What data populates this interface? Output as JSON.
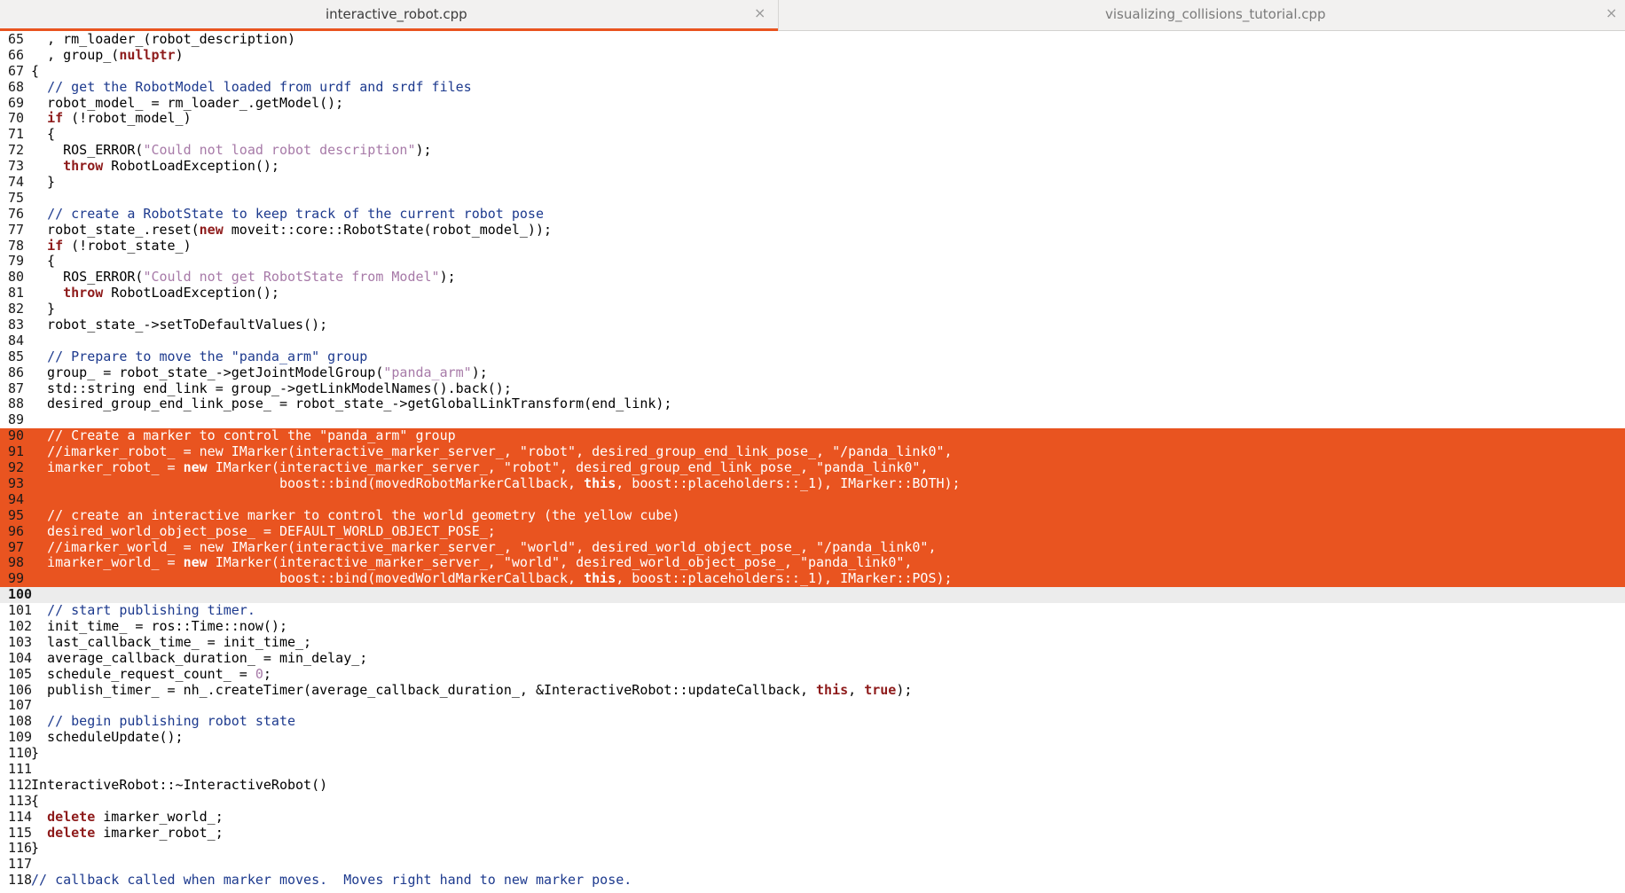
{
  "tabs": [
    {
      "label": "interactive_robot.cpp",
      "close": "×",
      "active": true
    },
    {
      "label": "visualizing_collisions_tutorial.cpp",
      "close": "×",
      "active": false
    }
  ],
  "icons": {
    "tab_close": "close-icon"
  },
  "colors": {
    "selection": "#e95420",
    "tab_accent": "#e9541f",
    "comment": "#1d3a8e",
    "string": "#a77aa8",
    "keyword": "#8e1b1b",
    "current_line": "#ececec"
  },
  "editor": {
    "current_line": 100,
    "selection": [
      90,
      99
    ],
    "lines": [
      {
        "n": "65",
        "segs": [
          {
            "t": "  , rm_loader_(robot_description)"
          }
        ]
      },
      {
        "n": "66",
        "segs": [
          {
            "t": "  , group_("
          },
          {
            "t": "nullptr",
            "c": "kw"
          },
          {
            "t": ")"
          }
        ]
      },
      {
        "n": "67",
        "segs": [
          {
            "t": "{"
          }
        ]
      },
      {
        "n": "68",
        "segs": [
          {
            "t": "  "
          },
          {
            "t": "// get the RobotModel loaded from urdf and srdf files",
            "c": "cm"
          }
        ]
      },
      {
        "n": "69",
        "segs": [
          {
            "t": "  robot_model_ = rm_loader_.getModel();"
          }
        ]
      },
      {
        "n": "70",
        "segs": [
          {
            "t": "  "
          },
          {
            "t": "if",
            "c": "kw"
          },
          {
            "t": " (!robot_model_)"
          }
        ]
      },
      {
        "n": "71",
        "segs": [
          {
            "t": "  {"
          }
        ]
      },
      {
        "n": "72",
        "segs": [
          {
            "t": "    ROS_ERROR("
          },
          {
            "t": "\"Could not load robot description\"",
            "c": "st"
          },
          {
            "t": ");"
          }
        ]
      },
      {
        "n": "73",
        "segs": [
          {
            "t": "    "
          },
          {
            "t": "throw",
            "c": "kw"
          },
          {
            "t": " RobotLoadException();"
          }
        ]
      },
      {
        "n": "74",
        "segs": [
          {
            "t": "  }"
          }
        ]
      },
      {
        "n": "75",
        "segs": [
          {
            "t": ""
          }
        ]
      },
      {
        "n": "76",
        "segs": [
          {
            "t": "  "
          },
          {
            "t": "// create a RobotState to keep track of the current robot pose",
            "c": "cm"
          }
        ]
      },
      {
        "n": "77",
        "segs": [
          {
            "t": "  robot_state_.reset("
          },
          {
            "t": "new",
            "c": "kw"
          },
          {
            "t": " moveit::core::RobotState(robot_model_));"
          }
        ]
      },
      {
        "n": "78",
        "segs": [
          {
            "t": "  "
          },
          {
            "t": "if",
            "c": "kw"
          },
          {
            "t": " (!robot_state_)"
          }
        ]
      },
      {
        "n": "79",
        "segs": [
          {
            "t": "  {"
          }
        ]
      },
      {
        "n": "80",
        "segs": [
          {
            "t": "    ROS_ERROR("
          },
          {
            "t": "\"Could not get RobotState from Model\"",
            "c": "st"
          },
          {
            "t": ");"
          }
        ]
      },
      {
        "n": "81",
        "segs": [
          {
            "t": "    "
          },
          {
            "t": "throw",
            "c": "kw"
          },
          {
            "t": " RobotLoadException();"
          }
        ]
      },
      {
        "n": "82",
        "segs": [
          {
            "t": "  }"
          }
        ]
      },
      {
        "n": "83",
        "segs": [
          {
            "t": "  robot_state_->setToDefaultValues();"
          }
        ]
      },
      {
        "n": "84",
        "segs": [
          {
            "t": ""
          }
        ]
      },
      {
        "n": "85",
        "segs": [
          {
            "t": "  "
          },
          {
            "t": "// Prepare to move the \"panda_arm\" group",
            "c": "cm"
          }
        ]
      },
      {
        "n": "86",
        "segs": [
          {
            "t": "  group_ = robot_state_->getJointModelGroup("
          },
          {
            "t": "\"panda_arm\"",
            "c": "st"
          },
          {
            "t": ");"
          }
        ]
      },
      {
        "n": "87",
        "segs": [
          {
            "t": "  std::string end_link = group_->getLinkModelNames().back();"
          }
        ]
      },
      {
        "n": "88",
        "segs": [
          {
            "t": "  desired_group_end_link_pose_ = robot_state_->getGlobalLinkTransform(end_link);"
          }
        ]
      },
      {
        "n": "89",
        "segs": [
          {
            "t": ""
          }
        ]
      },
      {
        "n": "90",
        "segs": [
          {
            "t": "  "
          },
          {
            "t": "// Create a marker to control the \"panda_arm\" group",
            "c": "cm"
          }
        ]
      },
      {
        "n": "91",
        "segs": [
          {
            "t": "  "
          },
          {
            "t": "//imarker_robot_ = new IMarker(interactive_marker_server_, \"robot\", desired_group_end_link_pose_, \"/panda_link0\",",
            "c": "cm"
          }
        ]
      },
      {
        "n": "92",
        "segs": [
          {
            "t": "  imarker_robot_ = "
          },
          {
            "t": "new",
            "c": "kw"
          },
          {
            "t": " IMarker(interactive_marker_server_, "
          },
          {
            "t": "\"robot\"",
            "c": "st"
          },
          {
            "t": ", desired_group_end_link_pose_, "
          },
          {
            "t": "\"panda_link0\"",
            "c": "st"
          },
          {
            "t": ","
          }
        ]
      },
      {
        "n": "93",
        "segs": [
          {
            "t": "                               boost::bind(movedRobotMarkerCallback, "
          },
          {
            "t": "this",
            "c": "kw"
          },
          {
            "t": ", boost::placeholders::_1), IMarker::BOTH);"
          }
        ]
      },
      {
        "n": "94",
        "segs": [
          {
            "t": ""
          }
        ]
      },
      {
        "n": "95",
        "segs": [
          {
            "t": "  "
          },
          {
            "t": "// create an interactive marker to control the world geometry (the yellow cube)",
            "c": "cm"
          }
        ]
      },
      {
        "n": "96",
        "segs": [
          {
            "t": "  desired_world_object_pose_ = DEFAULT_WORLD_OBJECT_POSE_;"
          }
        ]
      },
      {
        "n": "97",
        "segs": [
          {
            "t": "  "
          },
          {
            "t": "//imarker_world_ = new IMarker(interactive_marker_server_, \"world\", desired_world_object_pose_, \"/panda_link0\",",
            "c": "cm"
          }
        ]
      },
      {
        "n": "98",
        "segs": [
          {
            "t": "  imarker_world_ = "
          },
          {
            "t": "new",
            "c": "kw"
          },
          {
            "t": " IMarker(interactive_marker_server_, "
          },
          {
            "t": "\"world\"",
            "c": "st"
          },
          {
            "t": ", desired_world_object_pose_, "
          },
          {
            "t": "\"panda_link0\"",
            "c": "st"
          },
          {
            "t": ","
          }
        ]
      },
      {
        "n": "99",
        "segs": [
          {
            "t": "                               boost::bind(movedWorldMarkerCallback, "
          },
          {
            "t": "this",
            "c": "kw"
          },
          {
            "t": ", boost::placeholders::_1), IMarker::POS);"
          }
        ]
      },
      {
        "n": "100",
        "segs": [
          {
            "t": ""
          }
        ]
      },
      {
        "n": "101",
        "segs": [
          {
            "t": "  "
          },
          {
            "t": "// start publishing timer.",
            "c": "cm"
          }
        ]
      },
      {
        "n": "102",
        "segs": [
          {
            "t": "  init_time_ = ros::Time::now();"
          }
        ]
      },
      {
        "n": "103",
        "segs": [
          {
            "t": "  last_callback_time_ = init_time_;"
          }
        ]
      },
      {
        "n": "104",
        "segs": [
          {
            "t": "  average_callback_duration_ = min_delay_;"
          }
        ]
      },
      {
        "n": "105",
        "segs": [
          {
            "t": "  schedule_request_count_ = "
          },
          {
            "t": "0",
            "c": "st"
          },
          {
            "t": ";"
          }
        ]
      },
      {
        "n": "106",
        "segs": [
          {
            "t": "  publish_timer_ = nh_.createTimer(average_callback_duration_, &InteractiveRobot::updateCallback, "
          },
          {
            "t": "this",
            "c": "kw"
          },
          {
            "t": ", "
          },
          {
            "t": "true",
            "c": "kw"
          },
          {
            "t": ");"
          }
        ]
      },
      {
        "n": "107",
        "segs": [
          {
            "t": ""
          }
        ]
      },
      {
        "n": "108",
        "segs": [
          {
            "t": "  "
          },
          {
            "t": "// begin publishing robot state",
            "c": "cm"
          }
        ]
      },
      {
        "n": "109",
        "segs": [
          {
            "t": "  scheduleUpdate();"
          }
        ]
      },
      {
        "n": "110",
        "segs": [
          {
            "t": "}"
          }
        ]
      },
      {
        "n": "111",
        "segs": [
          {
            "t": ""
          }
        ]
      },
      {
        "n": "112",
        "segs": [
          {
            "t": "InteractiveRobot::~InteractiveRobot()"
          }
        ]
      },
      {
        "n": "113",
        "segs": [
          {
            "t": "{"
          }
        ]
      },
      {
        "n": "114",
        "segs": [
          {
            "t": "  "
          },
          {
            "t": "delete",
            "c": "kw"
          },
          {
            "t": " imarker_world_;"
          }
        ]
      },
      {
        "n": "115",
        "segs": [
          {
            "t": "  "
          },
          {
            "t": "delete",
            "c": "kw"
          },
          {
            "t": " imarker_robot_;"
          }
        ]
      },
      {
        "n": "116",
        "segs": [
          {
            "t": "}"
          }
        ]
      },
      {
        "n": "117",
        "segs": [
          {
            "t": ""
          }
        ]
      },
      {
        "n": "118",
        "segs": [
          {
            "t": ""
          },
          {
            "t": "// callback called when marker moves.  Moves right hand to new marker pose.",
            "c": "cm"
          }
        ]
      }
    ]
  }
}
